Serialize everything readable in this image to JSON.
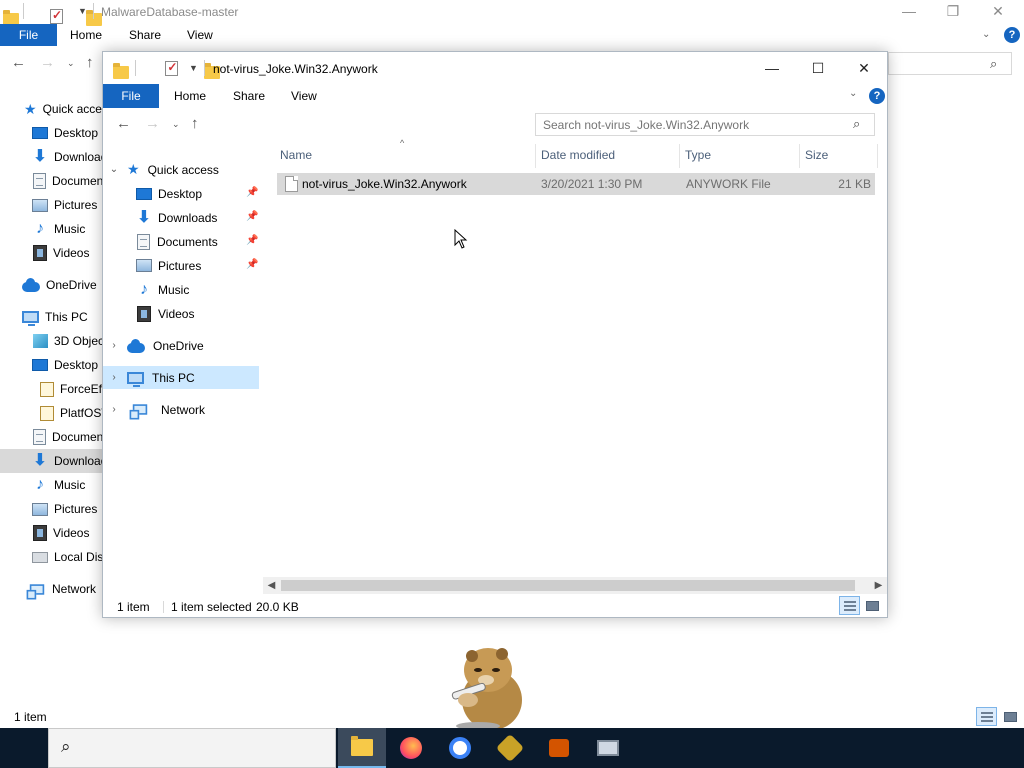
{
  "background_window": {
    "title": "MalwareDatabase-master",
    "ribbon_tabs": {
      "file": "File",
      "home": "Home",
      "share": "Share",
      "view": "View"
    },
    "sidebar": [
      {
        "label": "Quick access",
        "icon": "star-icon"
      },
      {
        "label": "Desktop",
        "icon": "desktop-icon"
      },
      {
        "label": "Downloads",
        "icon": "download-icon"
      },
      {
        "label": "Documents",
        "icon": "documents-icon"
      },
      {
        "label": "Pictures",
        "icon": "pictures-icon"
      },
      {
        "label": "Music",
        "icon": "music-icon"
      },
      {
        "label": "Videos",
        "icon": "videos-icon"
      },
      {
        "label": "OneDrive",
        "icon": "onedrive-icon"
      },
      {
        "label": "This PC",
        "icon": "this-pc-icon"
      },
      {
        "label": "3D Objects",
        "icon": "3d-objects-icon"
      },
      {
        "label": "Desktop",
        "icon": "desktop-icon"
      },
      {
        "label": "ForceEff",
        "icon": "shortcut-icon"
      },
      {
        "label": "PlatfOSV",
        "icon": "shortcut-icon"
      },
      {
        "label": "Documents",
        "icon": "documents-icon"
      },
      {
        "label": "Downloads",
        "icon": "download-icon"
      },
      {
        "label": "Music",
        "icon": "music-icon"
      },
      {
        "label": "Pictures",
        "icon": "pictures-icon"
      },
      {
        "label": "Videos",
        "icon": "videos-icon"
      },
      {
        "label": "Local Disk",
        "icon": "local-disk-icon"
      },
      {
        "label": "Network",
        "icon": "network-icon"
      }
    ],
    "status": {
      "item_count": "1 item"
    }
  },
  "foreground_window": {
    "title": "not-virus_Joke.Win32.Anywork",
    "ribbon_tabs": {
      "file": "File",
      "home": "Home",
      "share": "Share",
      "view": "View"
    },
    "search": {
      "placeholder": "Search not-virus_Joke.Win32.Anywork"
    },
    "sidebar": {
      "quick_access": "Quick access",
      "desktop": "Desktop",
      "downloads": "Downloads",
      "documents": "Documents",
      "pictures": "Pictures",
      "music": "Music",
      "videos": "Videos",
      "onedrive": "OneDrive",
      "this_pc": "This PC",
      "network": "Network"
    },
    "columns": {
      "name": "Name",
      "date_modified": "Date modified",
      "type": "Type",
      "size": "Size"
    },
    "files": [
      {
        "name": "not-virus_Joke.Win32.Anywork",
        "date_modified": "3/20/2021 1:30 PM",
        "type": "ANYWORK File",
        "size": "21 KB"
      }
    ],
    "status": {
      "item_count": "1 item",
      "selection": "1 item selected",
      "selection_size": "20.0 KB"
    }
  },
  "colors": {
    "accent": "#1565c0",
    "selection": "#cce8ff",
    "taskbar": "#0a1a2c"
  },
  "taskbar": {
    "apps": [
      "file-explorer-icon",
      "firefox-icon",
      "chrome-icon",
      "app-icon",
      "app-icon",
      "app-icon"
    ]
  }
}
